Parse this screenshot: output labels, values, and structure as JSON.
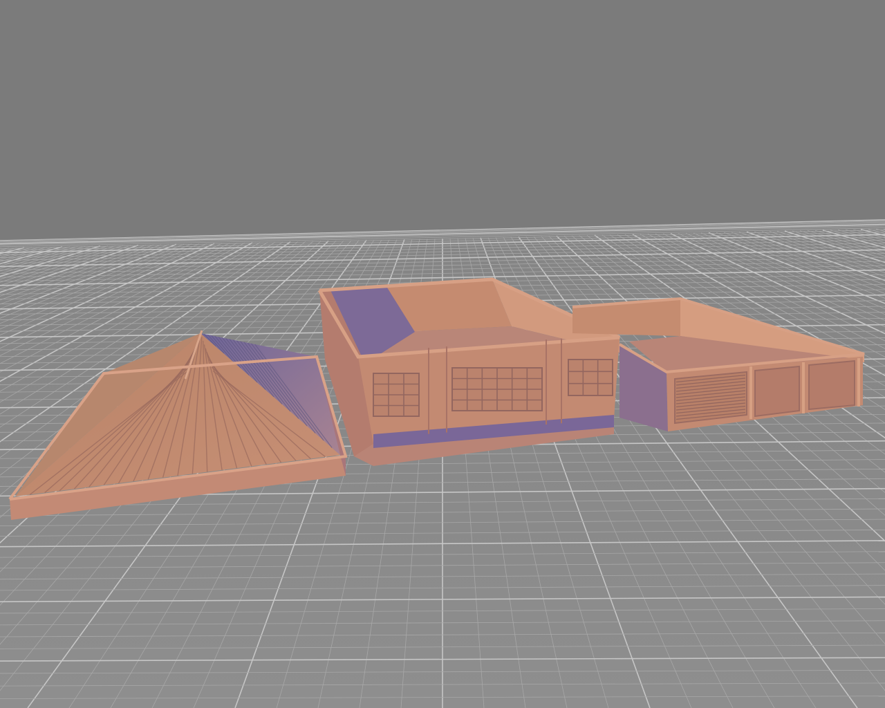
{
  "scene": {
    "sky_color": "#7b7b7b",
    "floor_color": "#8c8c8c",
    "grid_line_color": "#a8a8a8",
    "grid_major_color": "#c6c6c6",
    "model_color": "#c98e72",
    "model_light": "#d9a084",
    "model_dark": "#9f6f63",
    "shadow_color": "#6b6295"
  },
  "objects": [
    {
      "name": "hip-roof-piece",
      "label": ""
    },
    {
      "name": "main-building-shell",
      "label": ""
    },
    {
      "name": "garage-wing-shell",
      "label": ""
    }
  ]
}
